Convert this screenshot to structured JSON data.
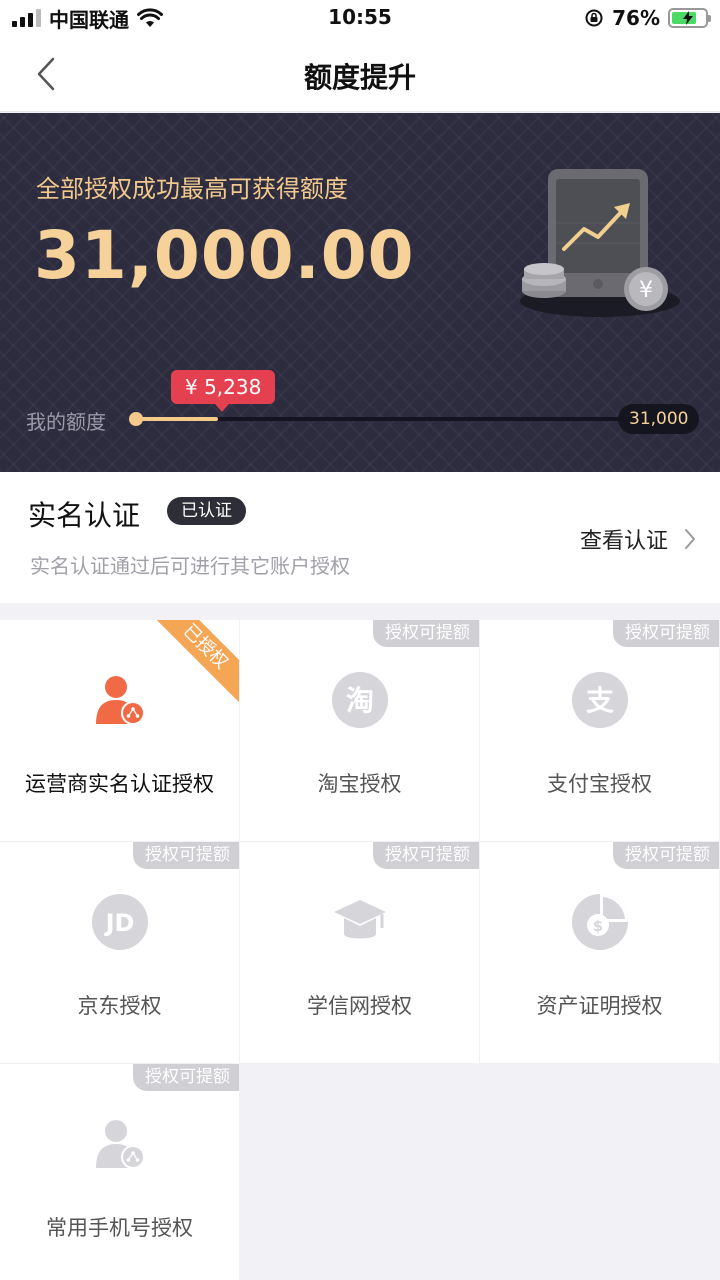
{
  "status_bar": {
    "carrier": "中国联通",
    "time": "10:55",
    "battery_percent": "76%",
    "battery_level": 0.76
  },
  "nav": {
    "title": "额度提升"
  },
  "hero": {
    "subtitle": "全部授权成功最高可获得额度",
    "amount": "31,000.00",
    "my_limit_label": "我的额度",
    "current_value": "¥ 5,238",
    "max_value": "31,000",
    "progress_fraction": 0.169
  },
  "realname": {
    "title": "实名认证",
    "badge": "已认证",
    "description": "实名认证通过后可进行其它账户授权",
    "link_label": "查看认证"
  },
  "auth_tiles": [
    {
      "label": "运营商实名认证授权",
      "icon": "operator-user-icon",
      "status": "已授权",
      "color": "#f26a45"
    },
    {
      "label": "淘宝授权",
      "icon": "taobao-icon",
      "status": "授权可提额"
    },
    {
      "label": "支付宝授权",
      "icon": "alipay-icon",
      "status": "授权可提额"
    },
    {
      "label": "京东授权",
      "icon": "jd-icon",
      "status": "授权可提额"
    },
    {
      "label": "学信网授权",
      "icon": "graduation-cap-icon",
      "status": "授权可提额"
    },
    {
      "label": "资产证明授权",
      "icon": "asset-chart-icon",
      "status": "授权可提额"
    },
    {
      "label": "常用手机号授权",
      "icon": "phone-user-icon",
      "status": "授权可提额"
    }
  ],
  "colors": {
    "accent_gold": "#f6d29a",
    "accent_red": "#e5404f",
    "ribbon_orange": "#f5a655",
    "hero_bg": "#2c2c3e"
  }
}
